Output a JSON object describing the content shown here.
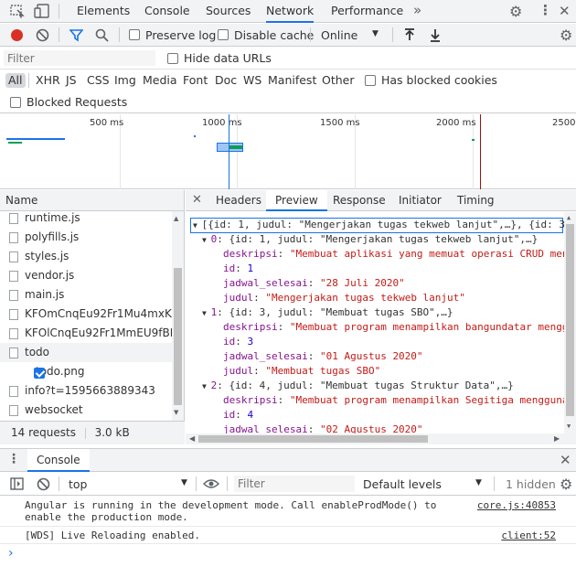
{
  "top_tabs": [
    "Elements",
    "Console",
    "Sources",
    "Network",
    "Performance"
  ],
  "active_top_tab": "Network",
  "network_toolbar": {
    "preserve_log": "Preserve log",
    "disable_cache": "Disable cache",
    "throttle": "Online"
  },
  "filter": {
    "placeholder": "Filter",
    "hide_data_urls": "Hide data URLs"
  },
  "type_filters": [
    "All",
    "XHR",
    "JS",
    "CSS",
    "Img",
    "Media",
    "Font",
    "Doc",
    "WS",
    "Manifest",
    "Other"
  ],
  "has_blocked_cookies": "Has blocked cookies",
  "blocked_requests": "Blocked Requests",
  "overview_ticks": [
    "500 ms",
    "1000 ms",
    "1500 ms",
    "2000 ms",
    "2500"
  ],
  "name_header": "Name",
  "requests": [
    {
      "name": "runtime.js",
      "checked": false
    },
    {
      "name": "polyfills.js",
      "checked": false
    },
    {
      "name": "styles.js",
      "checked": false
    },
    {
      "name": "vendor.js",
      "checked": false
    },
    {
      "name": "main.js",
      "checked": false
    },
    {
      "name": "KFOmCnqEu92Fr1Mu4mxK...",
      "checked": false
    },
    {
      "name": "KFOlCnqEu92Fr1MmEU9fBB...",
      "checked": false
    },
    {
      "name": "todo",
      "checked": false
    },
    {
      "name": "todo.png",
      "checked": true
    },
    {
      "name": "info?t=1595663889343",
      "checked": false
    },
    {
      "name": "websocket",
      "checked": false
    }
  ],
  "footer": {
    "requests": "14 requests",
    "transferred": "3.0 kB transferred"
  },
  "detail_tabs": [
    "Headers",
    "Preview",
    "Response",
    "Initiator",
    "Timing"
  ],
  "active_detail_tab": "Preview",
  "preview": {
    "root": "[{id: 1, judul: \"Mengerjakan tugas tekweb lanjut\",…}, {id: 3,",
    "items": [
      {
        "index": "0",
        "summary": "{id: 1, judul: \"Mengerjakan tugas tekweb lanjut\",…}",
        "deskripsi": "\"Membuat aplikasi yang memuat operasi CRUD men",
        "id": "1",
        "jadwal_selesai": "\"28 Juli 2020\"",
        "judul": "\"Mengerjakan tugas tekweb lanjut\""
      },
      {
        "index": "1",
        "summary": "{id: 3, judul: \"Membuat tugas SBO\",…}",
        "deskripsi": "\"Membuat program menampilkan bangundatar mengg",
        "id": "3",
        "jadwal_selesai": "\"01 Agustus 2020\"",
        "judul": "\"Membuat tugas SBO\""
      },
      {
        "index": "2",
        "summary": "{id: 4, judul: \"Membuat tugas Struktur Data\",…}",
        "deskripsi": "\"Membuat program menampilkan Segitiga mengguna",
        "id": "4",
        "jadwal_selesai": "\"02 Agustus 2020\""
      }
    ],
    "keys": {
      "deskripsi": "deskripsi",
      "id": "id",
      "jadwal_selesai": "jadwal_selesai",
      "judul": "judul"
    }
  },
  "drawer": {
    "tab": "Console"
  },
  "console_toolbar": {
    "context": "top",
    "filter_placeholder": "Filter",
    "levels": "Default levels",
    "hidden": "1 hidden"
  },
  "console_messages": [
    {
      "text1": "Angular is running in the development mode. Call enableProdMode() to",
      "text2": "enable the production mode.",
      "source": "core.js:40853"
    },
    {
      "text1": "[WDS] Live Reloading enabled.",
      "source": "client:52"
    }
  ],
  "colors": {
    "accent": "#1a73e8",
    "record": "#d93025"
  }
}
